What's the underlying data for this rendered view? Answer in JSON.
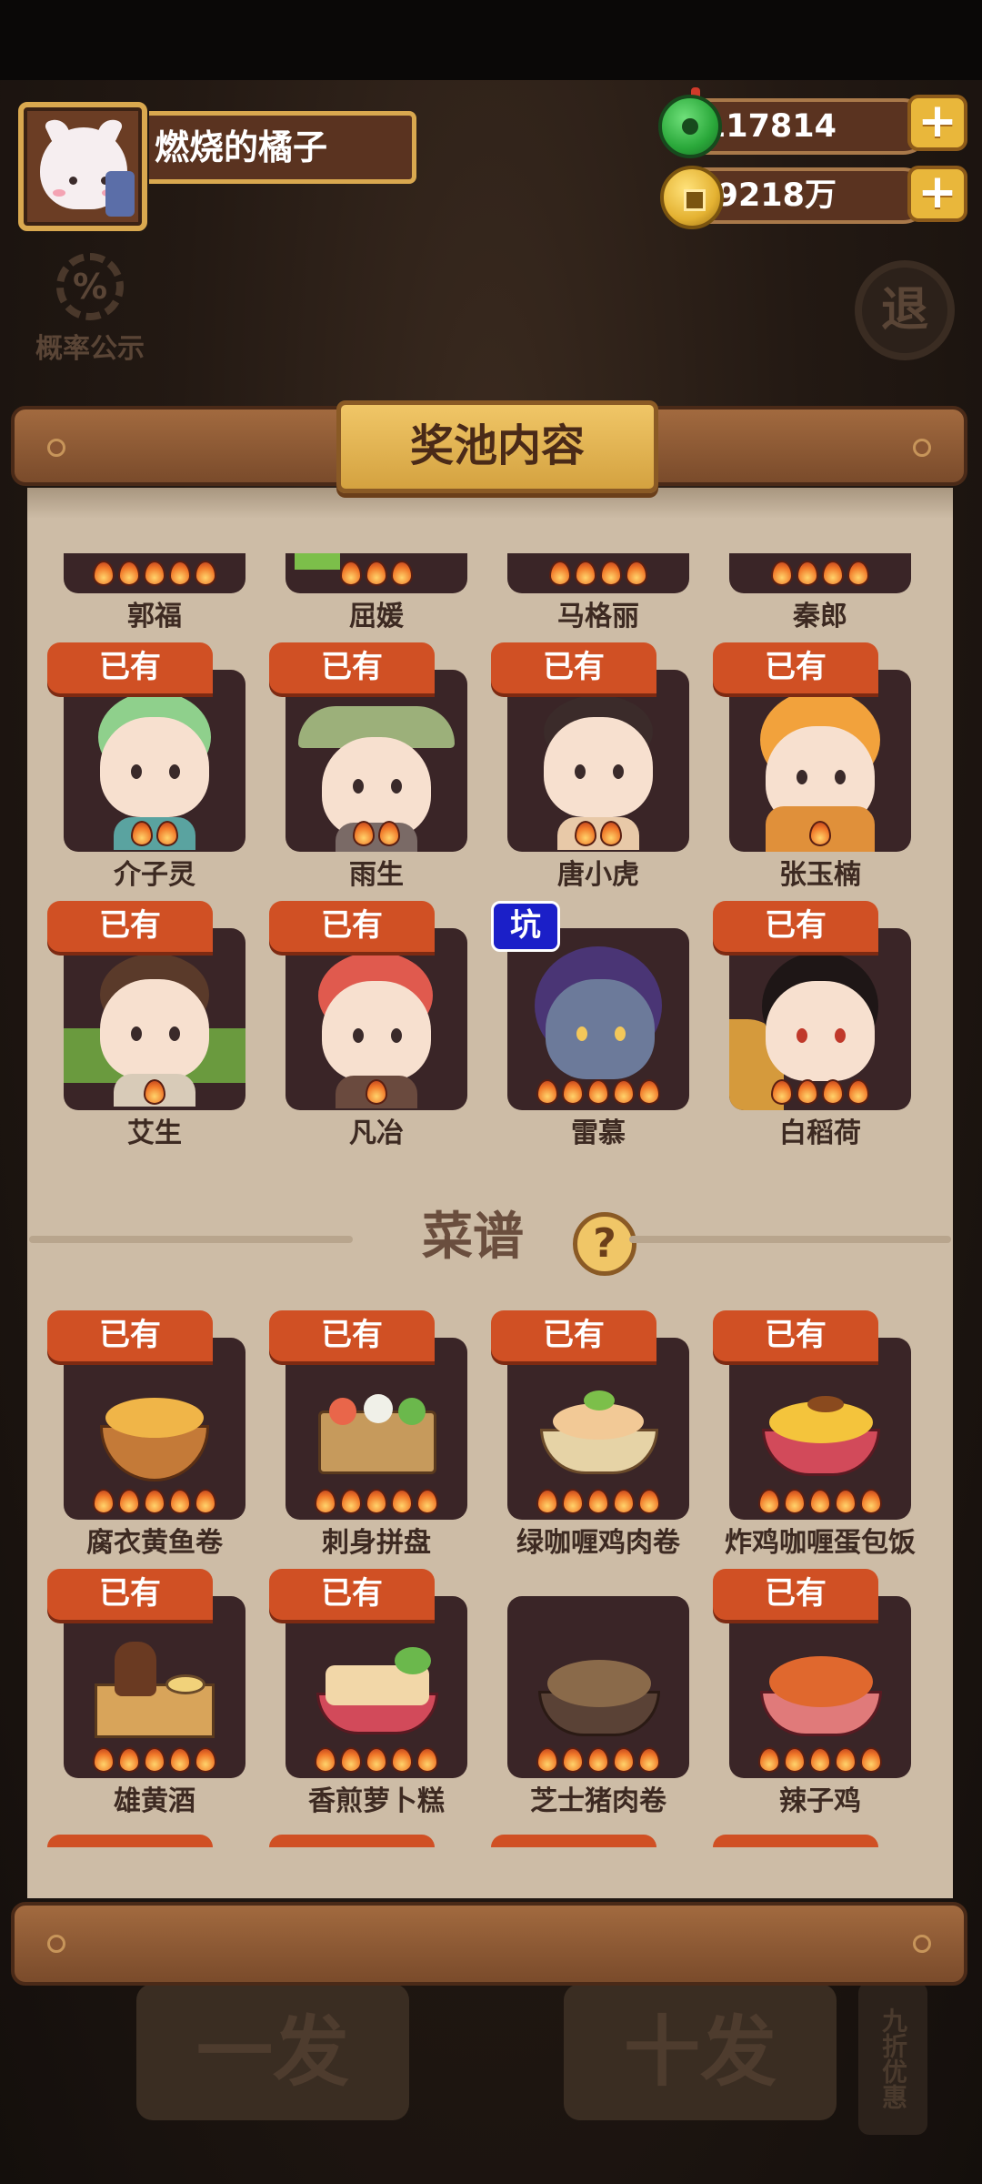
{
  "player": {
    "name": "燃烧的橘子"
  },
  "currency": {
    "jade": "117814",
    "coins": "39218万",
    "add_label": "+"
  },
  "background": {
    "rate_label": "概率公示",
    "rate_icon": "%",
    "exit_label": "退",
    "single_draw": "一发",
    "ten_draw": "十发",
    "discount": "九折优惠"
  },
  "panel": {
    "title": "奖池内容"
  },
  "characters_partial": [
    {
      "name": "郭福"
    },
    {
      "name": "屈媛"
    },
    {
      "name": "马格丽"
    },
    {
      "name": "秦郎"
    }
  ],
  "characters": [
    {
      "name": "介子灵",
      "tag": "已有",
      "stars": 2
    },
    {
      "name": "雨生",
      "tag": "已有",
      "stars": 2
    },
    {
      "name": "唐小虎",
      "tag": "已有",
      "stars": 2
    },
    {
      "name": "张玉楠",
      "tag": "已有",
      "stars": 1
    },
    {
      "name": "艾生",
      "tag": "已有",
      "stars": 1
    },
    {
      "name": "凡冶",
      "tag": "已有",
      "stars": 1
    },
    {
      "name": "雷慕",
      "tag": "坑",
      "stars": 5
    },
    {
      "name": "白稻荷",
      "tag": "已有",
      "stars": 4
    }
  ],
  "recipes_section": {
    "title": "菜谱",
    "help": "?"
  },
  "recipes": [
    {
      "name": "腐衣黄鱼卷",
      "tag": "已有",
      "stars": 5
    },
    {
      "name": "刺身拼盘",
      "tag": "已有",
      "stars": 5
    },
    {
      "name": "绿咖喱鸡肉卷",
      "tag": "已有",
      "stars": 5
    },
    {
      "name": "炸鸡咖喱蛋包饭",
      "tag": "已有",
      "stars": 5
    },
    {
      "name": "雄黄酒",
      "tag": "已有",
      "stars": 5
    },
    {
      "name": "香煎萝卜糕",
      "tag": "已有",
      "stars": 5
    },
    {
      "name": "芝士猪肉卷",
      "tag": "",
      "stars": 5
    },
    {
      "name": "辣子鸡",
      "tag": "已有",
      "stars": 5
    }
  ],
  "colors": {
    "tag_owned": "#d05024",
    "tag_pit": "#1b1fc8",
    "card_bg": "#3a2527",
    "paper": "#cdbca6",
    "gold": "#e9b73b"
  }
}
